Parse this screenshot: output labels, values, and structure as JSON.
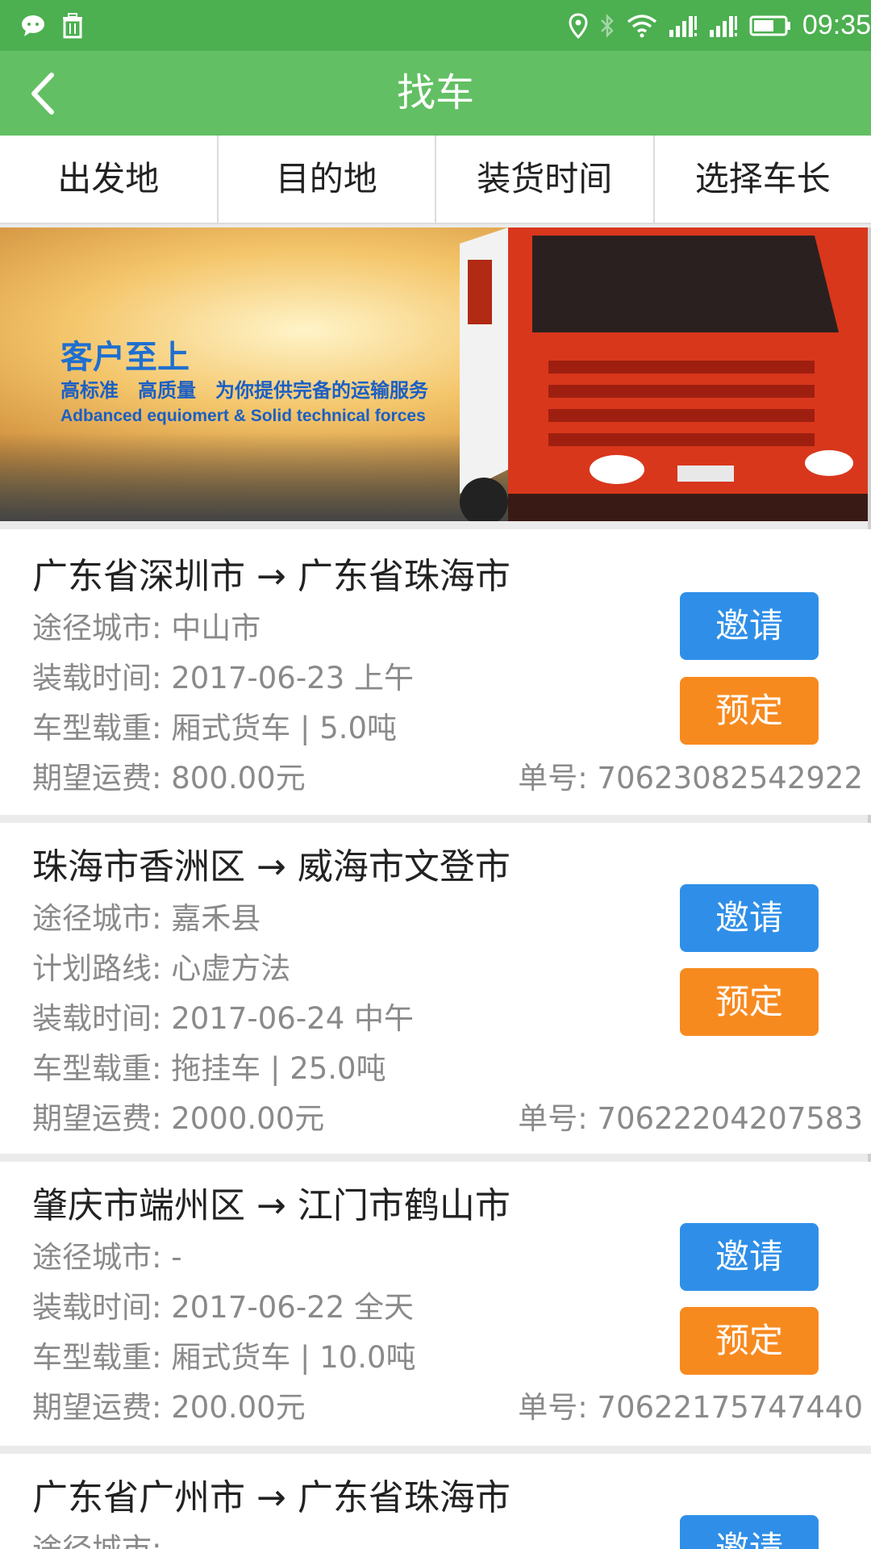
{
  "status_bar": {
    "time": "09:35",
    "icons": [
      "wechat-icon",
      "trash-icon",
      "location-icon",
      "bluetooth-icon",
      "wifi-icon",
      "signal-icon",
      "signal-icon",
      "battery-icon"
    ]
  },
  "header": {
    "title": "找车",
    "back_icon": "chevron-left-icon"
  },
  "filters": [
    "出发地",
    "目的地",
    "装货时间",
    "选择车长"
  ],
  "banner": {
    "title": "客户至上",
    "subtitle": "高标准　高质量　为你提供完备的运输服务",
    "english": "Adbanced equiomert & Solid technical forces"
  },
  "colors": {
    "green_bar": "#62bf63",
    "status_green": "#4caf50",
    "invite_blue": "#2f8fe8",
    "reserve_orange": "#f78a1f"
  },
  "listings": [
    {
      "route": "广东省深圳市 → 广东省珠海市",
      "lines": [
        "途径城市: 中山市",
        "装载时间: 2017-06-23 上午",
        "车型载重: 厢式货车 | 5.0吨",
        "期望运费: 800.00元"
      ],
      "order_no": "单号: 70623082542922",
      "invite": "邀请",
      "reserve": "预定"
    },
    {
      "route": "珠海市香洲区 → 威海市文登市",
      "lines": [
        "途径城市: 嘉禾县",
        "计划路线: 心虚方法",
        "装载时间: 2017-06-24 中午",
        "车型载重: 拖挂车 | 25.0吨",
        "期望运费: 2000.00元"
      ],
      "order_no": "单号: 70622204207583",
      "invite": "邀请",
      "reserve": "预定"
    },
    {
      "route": "肇庆市端州区 → 江门市鹤山市",
      "lines": [
        "途径城市: -",
        "装载时间: 2017-06-22 全天",
        "车型载重: 厢式货车 | 10.0吨",
        "期望运费: 200.00元"
      ],
      "order_no": "单号: 70622175747440",
      "invite": "邀请",
      "reserve": "预定"
    },
    {
      "route": "广东省广州市 → 广东省珠海市",
      "lines": [
        "途径城市: -"
      ],
      "invite": "邀请"
    }
  ]
}
